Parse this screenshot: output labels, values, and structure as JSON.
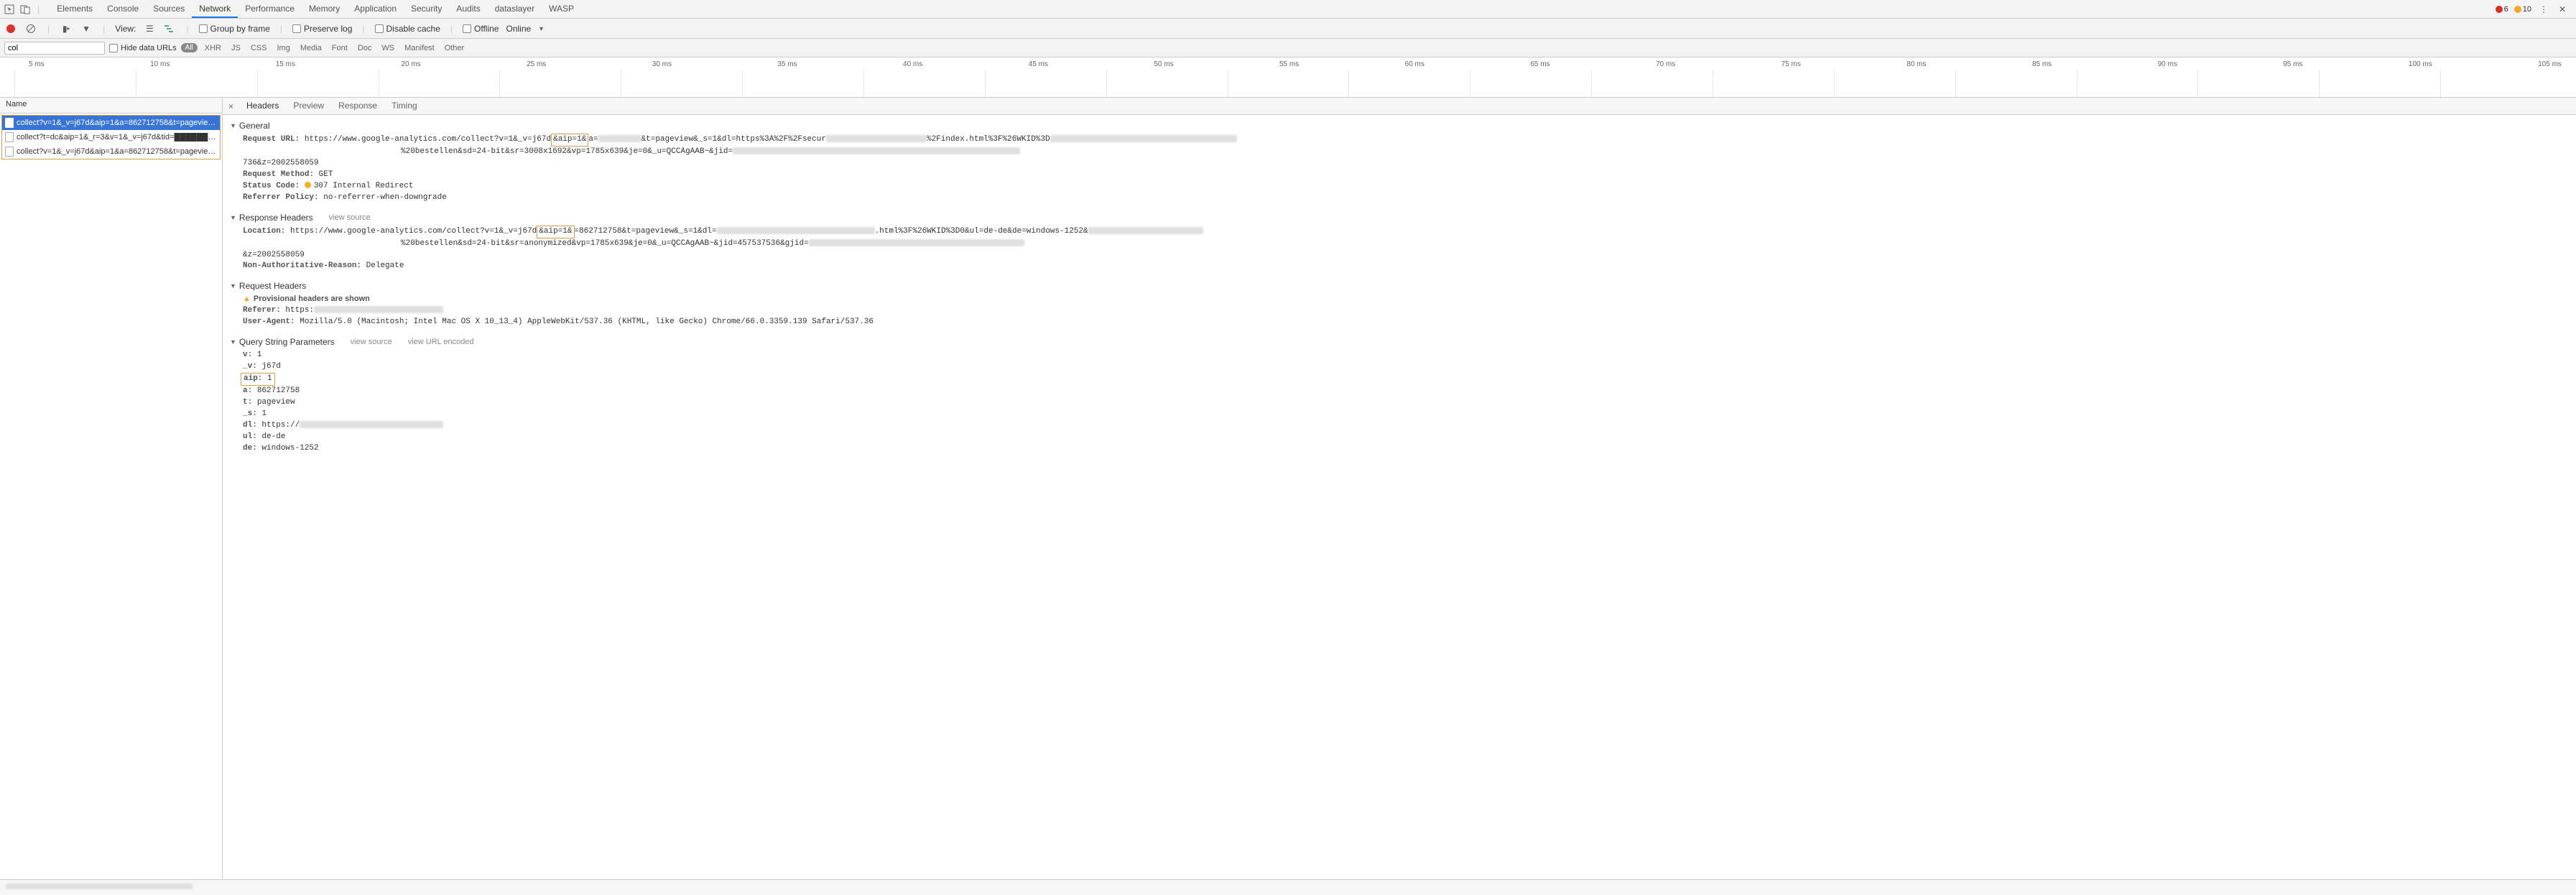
{
  "topbar": {
    "devtools_tabs": [
      "Elements",
      "Console",
      "Sources",
      "Network",
      "Performance",
      "Memory",
      "Application",
      "Security",
      "Audits",
      "dataslayer",
      "WASP"
    ],
    "active_tab": "Network",
    "errors": 6,
    "warnings": 10
  },
  "toolbar2": {
    "view_label": "View:",
    "group_by_frame": "Group by frame",
    "preserve_log": "Preserve log",
    "disable_cache": "Disable cache",
    "offline": "Offline",
    "online": "Online"
  },
  "toolbar3": {
    "filter_value": "col",
    "hide_data_urls": "Hide data URLs",
    "all": "All",
    "filter_types": [
      "XHR",
      "JS",
      "CSS",
      "Img",
      "Media",
      "Font",
      "Doc",
      "WS",
      "Manifest",
      "Other"
    ]
  },
  "timeline": {
    "ticks": [
      "5 ms",
      "10 ms",
      "15 ms",
      "20 ms",
      "25 ms",
      "30 ms",
      "35 ms",
      "40 ms",
      "45 ms",
      "50 ms",
      "55 ms",
      "60 ms",
      "65 ms",
      "70 ms",
      "75 ms",
      "80 ms",
      "85 ms",
      "90 ms",
      "95 ms",
      "100 ms",
      "105 ms"
    ]
  },
  "sidebar": {
    "header": "Name",
    "rows": [
      {
        "label": "collect?v=1&_v=j67d&aip=1&a=862712758&t=pageview&_…",
        "selected": true
      },
      {
        "label": "collect?t=dc&aip=1&_r=3&v=1&_v=j67d&tid=██████████ …",
        "selected": false
      },
      {
        "label": "collect?v=1&_v=j67d&aip=1&a=862712758&t=pageview&_…",
        "selected": false
      }
    ]
  },
  "detail_tabs": {
    "items": [
      "Headers",
      "Preview",
      "Response",
      "Timing"
    ],
    "active": "Headers"
  },
  "general": {
    "title": "General",
    "request_url_label": "Request URL:",
    "request_url_pre": "https://www.google-analytics.com/collect?v=1&_v=j67d",
    "request_url_hl": "&aip=1&",
    "request_url_mid1": "a=",
    "request_url_mid2": "&t=pageview&_s=1&dl=https%3A%2F%2Fsecur",
    "request_url_mid3": "%2Findex.html%3F%26WKID%3D",
    "request_url_line2_pre": "%20bestellen&sd=24-bit&sr=3008x1692&vp=1785x639&je=0&_u=QCCAgAAB~&jid=",
    "request_url_line3": "736&z=2002558059",
    "method_label": "Request Method:",
    "method": "GET",
    "status_label": "Status Code:",
    "status": "307 Internal Redirect",
    "referrer_policy_label": "Referrer Policy:",
    "referrer_policy": "no-referrer-when-downgrade"
  },
  "response_headers": {
    "title": "Response Headers",
    "view_source": "view source",
    "location_label": "Location:",
    "location_pre": "https://www.google-analytics.com/collect?v=1&_v=j67d",
    "location_hl": "&aip=1&",
    "location_mid": "=862712758&t=pageview&_s=1&dl=",
    "location_tail": ".html%3F%26WKID%3D0&ul=de-de&de=windows-1252&",
    "location_line2": "%20bestellen&sd=24-bit&sr=anonymized&vp=1785x639&je=0&_u=QCCAgAAB~&jid=457537536&gjid=",
    "location_line3": "&z=2002558059",
    "nar_label": "Non-Authoritative-Reason:",
    "nar": "Delegate"
  },
  "request_headers": {
    "title": "Request Headers",
    "provisional": "Provisional headers are shown",
    "referer_label": "Referer:",
    "referer": "https:",
    "ua_label": "User-Agent:",
    "ua": "Mozilla/5.0 (Macintosh; Intel Mac OS X 10_13_4) AppleWebKit/537.36 (KHTML, like Gecko) Chrome/66.0.3359.139 Safari/537.36"
  },
  "qsp": {
    "title": "Query String Parameters",
    "view_source": "view source",
    "view_url_encoded": "view URL encoded",
    "params": [
      {
        "k": "v",
        "v": "1"
      },
      {
        "k": "_v",
        "v": "j67d"
      },
      {
        "k": "aip",
        "v": "1",
        "highlight": true
      },
      {
        "k": "a",
        "v": "862712758"
      },
      {
        "k": "t",
        "v": "pageview"
      },
      {
        "k": "_s",
        "v": "1"
      },
      {
        "k": "dl",
        "v": "https://",
        "redact": true
      },
      {
        "k": "ul",
        "v": "de-de"
      },
      {
        "k": "de",
        "v": "windows-1252"
      }
    ]
  },
  "footer": {
    "text": ""
  }
}
